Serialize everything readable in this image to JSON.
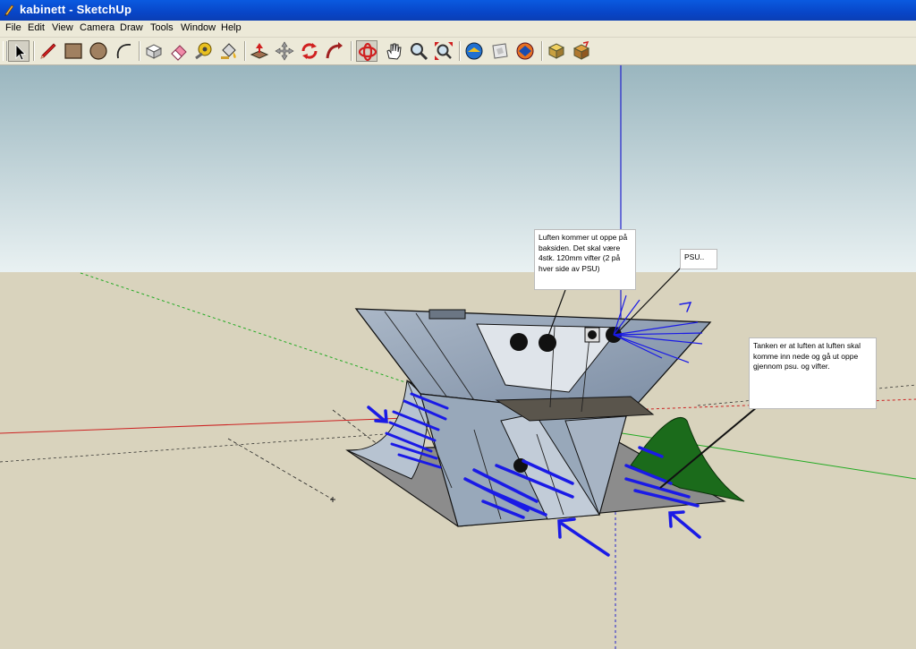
{
  "window": {
    "title": "kabinett - SketchUp"
  },
  "menu": [
    "File",
    "Edit",
    "View",
    "Camera",
    "Draw",
    "Tools",
    "Window",
    "Help"
  ],
  "toolbar": {
    "tools": [
      "select-icon",
      "pencil-icon",
      "rectangle-icon",
      "circle-icon",
      "arc-icon",
      "make-component-icon",
      "eraser-icon",
      "tape-measure-icon",
      "paint-bucket-icon",
      "push-pull-icon",
      "move-icon",
      "rotate-icon",
      "follow-me-icon",
      "orbit-icon",
      "pan-icon",
      "zoom-icon",
      "zoom-extents-icon",
      "previous-icon",
      "next-icon",
      "place-camera-icon",
      "component-browser-icon",
      "materials-icon"
    ]
  },
  "notes": {
    "air_out": "Luften kommer ut oppe på baksiden. Det skal være 4stk. 120mm vifter (2 på hver side av PSU)",
    "psu": "PSU..",
    "tank": "Tanken er at luften at luften skal komme inn nede og gå ut oppe gjennom psu. og vifter."
  },
  "colors": {
    "title_bar": "#0a50d8",
    "sky_top": "#9ab6bf",
    "sky_bottom": "#e8f0f1",
    "ground": "#d9d3bd",
    "arrows": "#1a1ae6",
    "red_axis": "#cc2222",
    "green_axis": "#22aa22",
    "blue_axis": "#2222cc"
  }
}
